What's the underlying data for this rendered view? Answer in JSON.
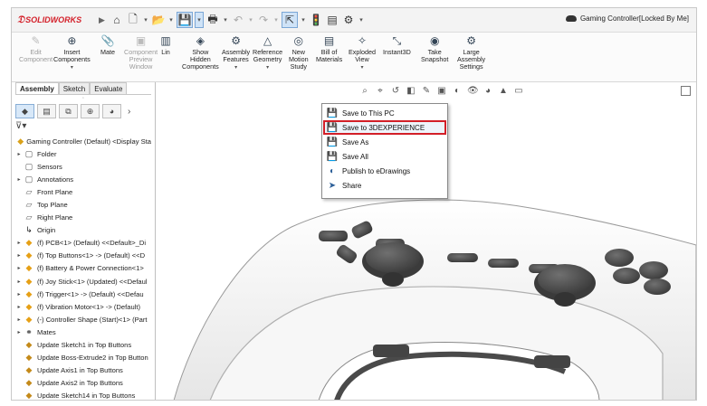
{
  "app": {
    "logo": "SOLIDWORKS",
    "document_title": "Gaming Controller[Locked By Me]"
  },
  "quick_access": {
    "icons": [
      "home-icon",
      "new-file-icon",
      "open-icon",
      "save-icon",
      "print-icon",
      "undo-icon",
      "redo-icon",
      "select-icon",
      "rebuild-icon",
      "file-properties-icon",
      "options-icon"
    ]
  },
  "ribbon": {
    "buttons": [
      {
        "label": "Edit\nComponent",
        "icon": "✎",
        "disabled": true
      },
      {
        "label": "Insert\nComponents",
        "icon": "⊕",
        "disabled": false,
        "dropdown": true
      },
      {
        "label": "Mate",
        "icon": "📎",
        "disabled": false
      },
      {
        "label": "Component\nPreview\nWindow",
        "icon": "▣",
        "disabled": true
      },
      {
        "label": "Lin",
        "icon": "▥",
        "disabled": false
      },
      {
        "label": "Show\nHidden\nComponents",
        "icon": "◈",
        "disabled": false
      },
      {
        "label": "Assembly\nFeatures",
        "icon": "⚙",
        "disabled": false,
        "dropdown": true
      },
      {
        "label": "Reference\nGeometry",
        "icon": "△",
        "disabled": false,
        "dropdown": true
      },
      {
        "label": "New\nMotion\nStudy",
        "icon": "◎",
        "disabled": false
      },
      {
        "label": "Bill of\nMaterials",
        "icon": "▤",
        "disabled": false
      },
      {
        "label": "Exploded\nView",
        "icon": "✧",
        "disabled": false,
        "dropdown": true
      },
      {
        "label": "Instant3D",
        "icon": "⤡",
        "disabled": false
      },
      {
        "label": "Take\nSnapshot",
        "icon": "◉",
        "disabled": false
      },
      {
        "label": "Large\nAssembly\nSettings",
        "icon": "⚙",
        "disabled": false
      }
    ]
  },
  "save_menu": {
    "items": [
      {
        "label": "Save to This PC",
        "icon": "💾",
        "highlight": false
      },
      {
        "label": "Save to 3DEXPERIENCE",
        "icon": "💾",
        "highlight": true
      },
      {
        "label": "Save As",
        "icon": "💾",
        "highlight": false
      },
      {
        "label": "Save All",
        "icon": "💾",
        "highlight": false
      },
      {
        "label": "Publish to eDrawings",
        "icon": "◐",
        "highlight": false
      },
      {
        "label": "Share",
        "icon": "➤",
        "highlight": false
      }
    ]
  },
  "left_panel": {
    "tabs": [
      "Assembly",
      "Sketch",
      "Evaluate"
    ],
    "active_tab": "Assembly",
    "tree": [
      {
        "label": "Gaming Controller (Default) <Display Sta",
        "icon": "asm",
        "expander": "",
        "indent": 0
      },
      {
        "label": "Folder",
        "icon": "folder",
        "expander": "▸",
        "indent": 1
      },
      {
        "label": "Sensors",
        "icon": "folder",
        "expander": "",
        "indent": 1
      },
      {
        "label": "Annotations",
        "icon": "folder",
        "expander": "▸",
        "indent": 1
      },
      {
        "label": "Front Plane",
        "icon": "plane",
        "expander": "",
        "indent": 1
      },
      {
        "label": "Top Plane",
        "icon": "plane",
        "expander": "",
        "indent": 1
      },
      {
        "label": "Right Plane",
        "icon": "plane",
        "expander": "",
        "indent": 1
      },
      {
        "label": "Origin",
        "icon": "origin",
        "expander": "",
        "indent": 1
      },
      {
        "label": "(f) PCB<1> (Default) <<Default>_Di",
        "icon": "part",
        "expander": "▸",
        "indent": 1
      },
      {
        "label": "(f) Top Buttons<1> -> (Default) <<D",
        "icon": "part",
        "expander": "▸",
        "indent": 1
      },
      {
        "label": "(f) Battery & Power Connection<1>",
        "icon": "part",
        "expander": "▸",
        "indent": 1
      },
      {
        "label": "(f) Joy Stick<1> (Updated) <<Defaul",
        "icon": "part",
        "expander": "▸",
        "indent": 1
      },
      {
        "label": "(f) Trigger<1> -> (Default) <<Defau",
        "icon": "part",
        "expander": "▸",
        "indent": 1
      },
      {
        "label": "(f) Vibration Motor<1> -> (Default)",
        "icon": "part",
        "expander": "▸",
        "indent": 1
      },
      {
        "label": "(-) Controller Shape (Start)<1> (Part",
        "icon": "part",
        "expander": "▸",
        "indent": 1
      },
      {
        "label": "Mates",
        "icon": "mates",
        "expander": "▸",
        "indent": 1
      },
      {
        "label": "Update Sketch1 in Top Buttons",
        "icon": "sketch",
        "expander": "",
        "indent": 1
      },
      {
        "label": "Update Boss-Extrude2 in Top Button",
        "icon": "sketch",
        "expander": "",
        "indent": 1
      },
      {
        "label": "Update Axis1 in Top Buttons",
        "icon": "sketch",
        "expander": "",
        "indent": 1
      },
      {
        "label": "Update Axis2 in Top Buttons",
        "icon": "sketch",
        "expander": "",
        "indent": 1
      },
      {
        "label": "Update Sketch14 in Top Buttons",
        "icon": "sketch",
        "expander": "",
        "indent": 1
      }
    ]
  },
  "colors": {
    "brand": "#d4202a",
    "highlight_border": "#d31f28",
    "controller_body": "#f4f4f4",
    "buttons": "#4a4a4a"
  }
}
